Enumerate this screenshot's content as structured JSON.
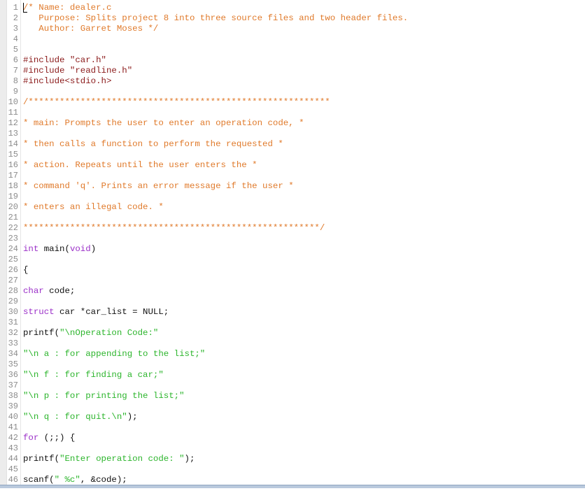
{
  "editor": {
    "filename": "dealer.c",
    "colors": {
      "comment": "#e07a2b",
      "preprocessor": "#8b1a1a",
      "keyword": "#9b30c8",
      "string": "#2db52d",
      "plain": "#111111",
      "line_number": "#8c8c8c"
    },
    "lines": [
      {
        "n": "1",
        "tokens": [
          {
            "t": "comment",
            "v": "/* Name: dealer.c"
          }
        ]
      },
      {
        "n": "2",
        "tokens": [
          {
            "t": "comment",
            "v": "   Purpose: Splits project 8 into three source files and two header files."
          }
        ]
      },
      {
        "n": "3",
        "tokens": [
          {
            "t": "comment",
            "v": "   Author: Garret Moses */"
          }
        ]
      },
      {
        "n": "4",
        "tokens": []
      },
      {
        "n": "5",
        "tokens": []
      },
      {
        "n": "6",
        "tokens": [
          {
            "t": "pre",
            "v": "#include \"car.h\""
          }
        ]
      },
      {
        "n": "7",
        "tokens": [
          {
            "t": "pre",
            "v": "#include \"readline.h\""
          }
        ]
      },
      {
        "n": "8",
        "tokens": [
          {
            "t": "pre",
            "v": "#include<stdio.h>"
          }
        ]
      },
      {
        "n": "9",
        "tokens": []
      },
      {
        "n": "10",
        "tokens": [
          {
            "t": "comment",
            "v": "/**********************************************************"
          }
        ]
      },
      {
        "n": "11",
        "tokens": []
      },
      {
        "n": "12",
        "tokens": [
          {
            "t": "comment",
            "v": "* main: Prompts the user to enter an operation code, *"
          }
        ]
      },
      {
        "n": "13",
        "tokens": []
      },
      {
        "n": "14",
        "tokens": [
          {
            "t": "comment",
            "v": "* then calls a function to perform the requested *"
          }
        ]
      },
      {
        "n": "15",
        "tokens": []
      },
      {
        "n": "16",
        "tokens": [
          {
            "t": "comment",
            "v": "* action. Repeats until the user enters the *"
          }
        ]
      },
      {
        "n": "17",
        "tokens": []
      },
      {
        "n": "18",
        "tokens": [
          {
            "t": "comment",
            "v": "* command 'q'. Prints an error message if the user *"
          }
        ]
      },
      {
        "n": "19",
        "tokens": []
      },
      {
        "n": "20",
        "tokens": [
          {
            "t": "comment",
            "v": "* enters an illegal code. *"
          }
        ]
      },
      {
        "n": "21",
        "tokens": []
      },
      {
        "n": "22",
        "tokens": [
          {
            "t": "comment",
            "v": "*********************************************************/"
          }
        ]
      },
      {
        "n": "23",
        "tokens": []
      },
      {
        "n": "24",
        "tokens": [
          {
            "t": "kw",
            "v": "int"
          },
          {
            "t": "plain",
            "v": " main("
          },
          {
            "t": "kw",
            "v": "void"
          },
          {
            "t": "plain",
            "v": ")"
          }
        ]
      },
      {
        "n": "25",
        "tokens": []
      },
      {
        "n": "26",
        "tokens": [
          {
            "t": "plain",
            "v": "{"
          }
        ]
      },
      {
        "n": "27",
        "tokens": []
      },
      {
        "n": "28",
        "tokens": [
          {
            "t": "kw",
            "v": "char"
          },
          {
            "t": "plain",
            "v": " code;"
          }
        ]
      },
      {
        "n": "29",
        "tokens": []
      },
      {
        "n": "30",
        "tokens": [
          {
            "t": "kw",
            "v": "struct"
          },
          {
            "t": "plain",
            "v": " car *car_list = NULL;"
          }
        ]
      },
      {
        "n": "31",
        "tokens": []
      },
      {
        "n": "32",
        "tokens": [
          {
            "t": "plain",
            "v": "printf("
          },
          {
            "t": "str",
            "v": "\"\\nOperation Code:\""
          }
        ]
      },
      {
        "n": "33",
        "tokens": []
      },
      {
        "n": "34",
        "tokens": [
          {
            "t": "str",
            "v": "\"\\n a : for appending to the list;\""
          }
        ]
      },
      {
        "n": "35",
        "tokens": []
      },
      {
        "n": "36",
        "tokens": [
          {
            "t": "str",
            "v": "\"\\n f : for finding a car;\""
          }
        ]
      },
      {
        "n": "37",
        "tokens": []
      },
      {
        "n": "38",
        "tokens": [
          {
            "t": "str",
            "v": "\"\\n p : for printing the list;\""
          }
        ]
      },
      {
        "n": "39",
        "tokens": []
      },
      {
        "n": "40",
        "tokens": [
          {
            "t": "str",
            "v": "\"\\n q : for quit.\\n\""
          },
          {
            "t": "plain",
            "v": ");"
          }
        ]
      },
      {
        "n": "41",
        "tokens": []
      },
      {
        "n": "42",
        "tokens": [
          {
            "t": "kw",
            "v": "for"
          },
          {
            "t": "plain",
            "v": " (;;) {"
          }
        ]
      },
      {
        "n": "43",
        "tokens": []
      },
      {
        "n": "44",
        "tokens": [
          {
            "t": "plain",
            "v": "printf("
          },
          {
            "t": "str",
            "v": "\"Enter operation code: \""
          },
          {
            "t": "plain",
            "v": ");"
          }
        ]
      },
      {
        "n": "45",
        "tokens": []
      },
      {
        "n": "46",
        "tokens": [
          {
            "t": "plain",
            "v": "scanf("
          },
          {
            "t": "str",
            "v": "\" %c\""
          },
          {
            "t": "plain",
            "v": ", &code);"
          }
        ]
      }
    ]
  }
}
